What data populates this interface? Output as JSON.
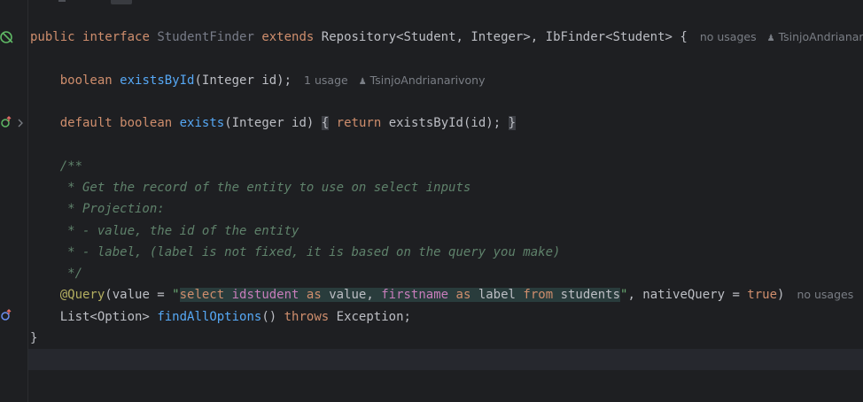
{
  "code": {
    "l1": {
      "kw_public": "public",
      "kw_interface": "interface",
      "name": "StudentFinder",
      "kw_extends": "extends",
      "types": "Repository<Student, Integer>, IbFinder<Student>",
      "brace": "{",
      "hint_usages": "no usages",
      "hint_author": "TsinjoAndrianarivony"
    },
    "l2": {
      "kw_boolean": "boolean",
      "method": "existsById",
      "params": "(Integer id);",
      "hint_usages": "1 usage",
      "hint_author": "TsinjoAndrianarivony"
    },
    "l3": {
      "kw_default": "default",
      "kw_boolean": "boolean",
      "method": "exists",
      "params": "(Integer id)",
      "open": "{",
      "kw_return": "return",
      "body": "existsById(id);",
      "close": "}"
    },
    "doc": [
      "/**",
      " * Get the record of the entity to use on select inputs",
      " * Projection:",
      " * - value, the id of the entity",
      " * - label, (label is not fixed, it is based on the query you make)",
      " */"
    ],
    "l4": {
      "annotation": "@Query",
      "pre": "(value = ",
      "q_open": "\"",
      "q_select": "select",
      "q_col1": "idstudent",
      "q_as1": "as",
      "q_val": "value,",
      "q_col2": "firstname",
      "q_as2": "as",
      "q_label": "label",
      "q_from": "from",
      "q_table": "students",
      "q_close": "\"",
      "mid": ", nativeQuery = ",
      "kw_true": "true",
      "paren": ")",
      "hint_usages": "no usages"
    },
    "l5": {
      "type": "List<Option>",
      "method": "findAllOptions",
      "parens": "()",
      "kw_throws": "throws",
      "exc": "Exception;"
    },
    "close_brace": "}"
  },
  "icons": {
    "interface_marker": "implemented-interface-icon",
    "override": "overriding-method-icon",
    "fold": "fold-chevron-icon",
    "implemented": "implemented-method-icon"
  },
  "colors": {
    "background": "#1e1f22",
    "keyword": "#cf8e6d",
    "function": "#56a8f5",
    "string": "#6aab73",
    "annotation": "#b3ae60",
    "doc_comment": "#5f826b"
  }
}
